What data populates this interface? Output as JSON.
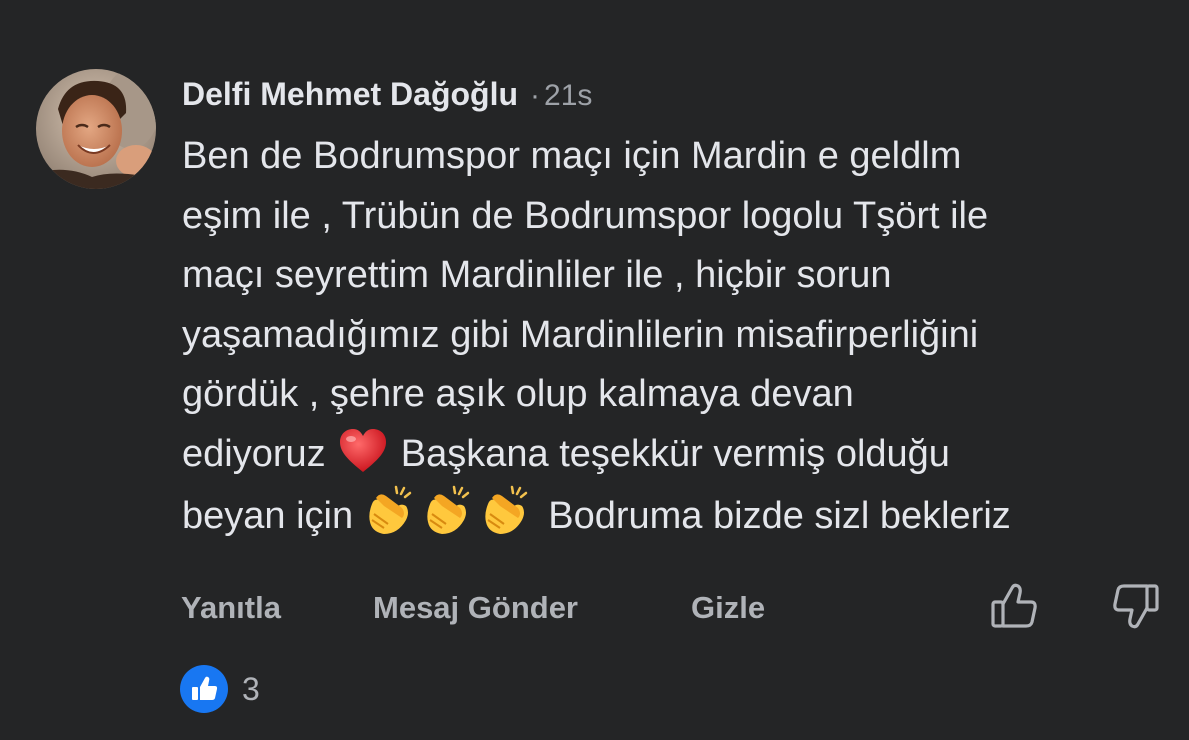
{
  "comment": {
    "author": "Delfi Mehmet Dağoğlu",
    "separator": "·",
    "time": "21s",
    "lines": [
      "Ben de Bodrumspor maçı için Mardin e geldlm",
      "eşim ile , Trübün de Bodrumspor logolu Tşört ile",
      "maçı seyrettim Mardinliler ile , hiçbir sorun",
      "yaşamadığımız  gibi Mardinlilerin misafirperliğini",
      "gördük , şehre aşık olup kalmaya devan",
      "ediyoruz ❤️ Başkana teşekkür vermiş olduğu",
      "beyan için 👏👏👏 Bodruma bizde sizl bekleriz"
    ],
    "line6_before": "ediyoruz",
    "line6_after": "Başkana teşekkür vermiş olduğu",
    "line7_before": "beyan için",
    "line7_after": "Bodruma bizde sizl bekleriz",
    "emoji_heart": "heart-emoji",
    "emoji_clap": "clapping-hands-emoji"
  },
  "actions": {
    "reply": "Yanıtla",
    "message": "Mesaj Gönder",
    "hide": "Gizle",
    "like_icon": "thumbs-up-outline-icon",
    "dislike_icon": "thumbs-down-outline-icon"
  },
  "reactions": {
    "icon": "like-reaction-icon",
    "count": "3",
    "color": "#1877f2"
  },
  "colors": {
    "background": "#242526",
    "primary_text": "#e4e6eb",
    "secondary_text": "#b0b3b8"
  }
}
